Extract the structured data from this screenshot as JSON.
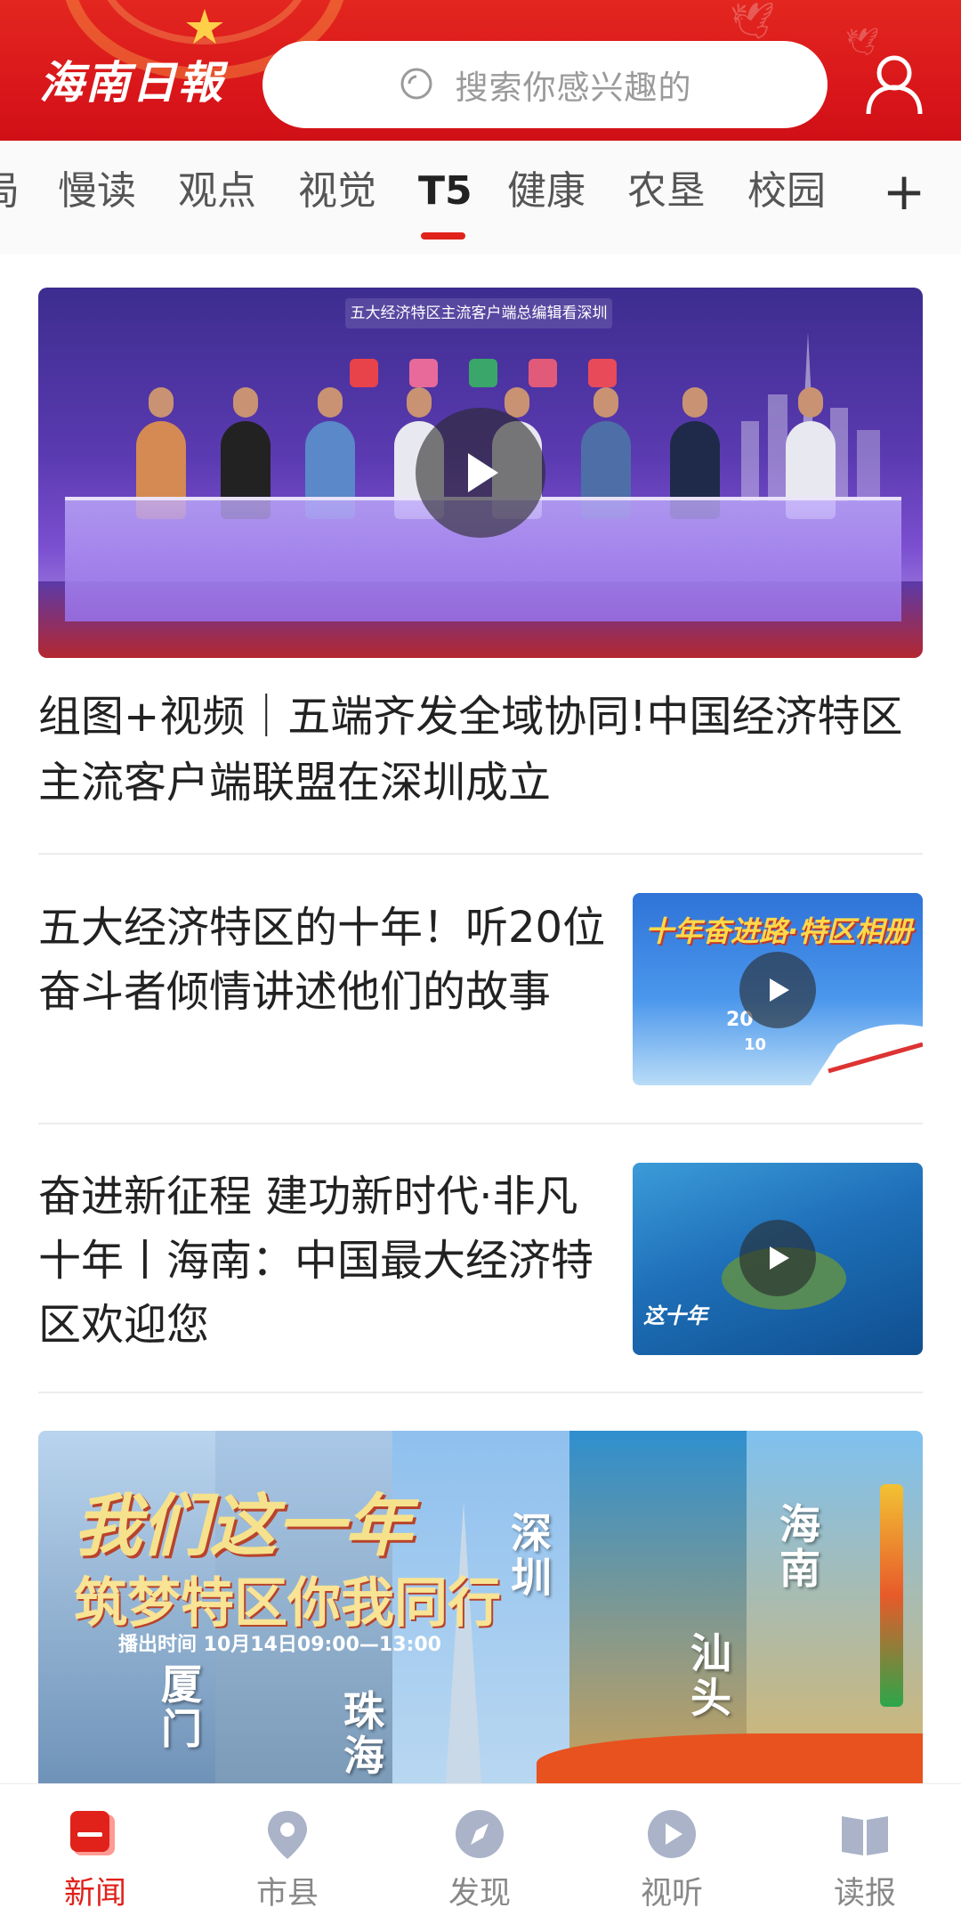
{
  "header": {
    "logo": "海南日報",
    "search_placeholder": "搜索你感兴趣的"
  },
  "tabs": [
    {
      "label": "局",
      "active": false
    },
    {
      "label": "慢读",
      "active": false
    },
    {
      "label": "观点",
      "active": false
    },
    {
      "label": "视觉",
      "active": false
    },
    {
      "label": "T5",
      "active": true
    },
    {
      "label": "健康",
      "active": false
    },
    {
      "label": "农垦",
      "active": false
    },
    {
      "label": "校园",
      "active": false
    }
  ],
  "tab_more": "+",
  "feature": {
    "image_banner": "五大经济特区主流客户端总编辑看深圳",
    "title": "组图+视频｜五端齐发全域协同!中国经济特区主流客户端联盟在深圳成立"
  },
  "items": [
    {
      "title": "五大经济特区的十年！听20位奋斗者倾情讲述他们的故事",
      "thumb_text_main": "十年奋进路·特区相册",
      "thumb_text_a": "20",
      "thumb_text_b": "10"
    },
    {
      "title": "奋进新征程 建功新时代·非凡十年丨海南：中国最大经济特区欢迎您",
      "thumb_text_main": "这十年"
    }
  ],
  "banner": {
    "title": "我们这一年",
    "subtitle": "筑梦特区你我同行",
    "time": "播出时间 10月14日09:00—13:00",
    "cities": [
      "厦门",
      "珠海",
      "深圳",
      "汕头",
      "海南"
    ]
  },
  "bottom_nav": [
    {
      "label": "新闻",
      "icon": "news-icon",
      "active": true
    },
    {
      "label": "市县",
      "icon": "location-pin-icon",
      "active": false
    },
    {
      "label": "发现",
      "icon": "compass-icon",
      "active": false
    },
    {
      "label": "视听",
      "icon": "play-video-icon",
      "active": false
    },
    {
      "label": "读报",
      "icon": "book-icon",
      "active": false
    }
  ],
  "colors": {
    "brand_red": "#e0221b",
    "header_red": "#d8151a",
    "inactive_gray": "#888888"
  }
}
